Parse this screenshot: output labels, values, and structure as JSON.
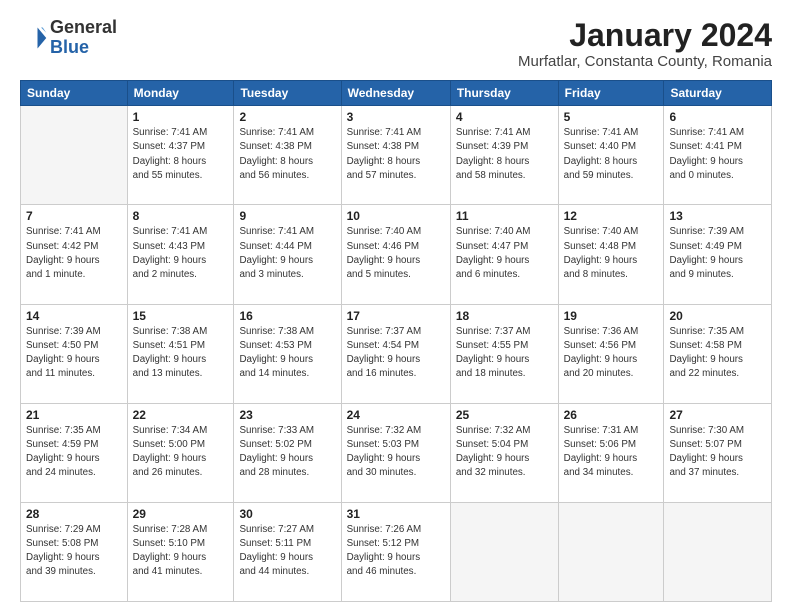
{
  "header": {
    "logo_general": "General",
    "logo_blue": "Blue",
    "title": "January 2024",
    "subtitle": "Murfatlar, Constanta County, Romania"
  },
  "weekdays": [
    "Sunday",
    "Monday",
    "Tuesday",
    "Wednesday",
    "Thursday",
    "Friday",
    "Saturday"
  ],
  "weeks": [
    [
      {
        "num": "",
        "info": ""
      },
      {
        "num": "1",
        "info": "Sunrise: 7:41 AM\nSunset: 4:37 PM\nDaylight: 8 hours\nand 55 minutes."
      },
      {
        "num": "2",
        "info": "Sunrise: 7:41 AM\nSunset: 4:38 PM\nDaylight: 8 hours\nand 56 minutes."
      },
      {
        "num": "3",
        "info": "Sunrise: 7:41 AM\nSunset: 4:38 PM\nDaylight: 8 hours\nand 57 minutes."
      },
      {
        "num": "4",
        "info": "Sunrise: 7:41 AM\nSunset: 4:39 PM\nDaylight: 8 hours\nand 58 minutes."
      },
      {
        "num": "5",
        "info": "Sunrise: 7:41 AM\nSunset: 4:40 PM\nDaylight: 8 hours\nand 59 minutes."
      },
      {
        "num": "6",
        "info": "Sunrise: 7:41 AM\nSunset: 4:41 PM\nDaylight: 9 hours\nand 0 minutes."
      }
    ],
    [
      {
        "num": "7",
        "info": "Sunrise: 7:41 AM\nSunset: 4:42 PM\nDaylight: 9 hours\nand 1 minute."
      },
      {
        "num": "8",
        "info": "Sunrise: 7:41 AM\nSunset: 4:43 PM\nDaylight: 9 hours\nand 2 minutes."
      },
      {
        "num": "9",
        "info": "Sunrise: 7:41 AM\nSunset: 4:44 PM\nDaylight: 9 hours\nand 3 minutes."
      },
      {
        "num": "10",
        "info": "Sunrise: 7:40 AM\nSunset: 4:46 PM\nDaylight: 9 hours\nand 5 minutes."
      },
      {
        "num": "11",
        "info": "Sunrise: 7:40 AM\nSunset: 4:47 PM\nDaylight: 9 hours\nand 6 minutes."
      },
      {
        "num": "12",
        "info": "Sunrise: 7:40 AM\nSunset: 4:48 PM\nDaylight: 9 hours\nand 8 minutes."
      },
      {
        "num": "13",
        "info": "Sunrise: 7:39 AM\nSunset: 4:49 PM\nDaylight: 9 hours\nand 9 minutes."
      }
    ],
    [
      {
        "num": "14",
        "info": "Sunrise: 7:39 AM\nSunset: 4:50 PM\nDaylight: 9 hours\nand 11 minutes."
      },
      {
        "num": "15",
        "info": "Sunrise: 7:38 AM\nSunset: 4:51 PM\nDaylight: 9 hours\nand 13 minutes."
      },
      {
        "num": "16",
        "info": "Sunrise: 7:38 AM\nSunset: 4:53 PM\nDaylight: 9 hours\nand 14 minutes."
      },
      {
        "num": "17",
        "info": "Sunrise: 7:37 AM\nSunset: 4:54 PM\nDaylight: 9 hours\nand 16 minutes."
      },
      {
        "num": "18",
        "info": "Sunrise: 7:37 AM\nSunset: 4:55 PM\nDaylight: 9 hours\nand 18 minutes."
      },
      {
        "num": "19",
        "info": "Sunrise: 7:36 AM\nSunset: 4:56 PM\nDaylight: 9 hours\nand 20 minutes."
      },
      {
        "num": "20",
        "info": "Sunrise: 7:35 AM\nSunset: 4:58 PM\nDaylight: 9 hours\nand 22 minutes."
      }
    ],
    [
      {
        "num": "21",
        "info": "Sunrise: 7:35 AM\nSunset: 4:59 PM\nDaylight: 9 hours\nand 24 minutes."
      },
      {
        "num": "22",
        "info": "Sunrise: 7:34 AM\nSunset: 5:00 PM\nDaylight: 9 hours\nand 26 minutes."
      },
      {
        "num": "23",
        "info": "Sunrise: 7:33 AM\nSunset: 5:02 PM\nDaylight: 9 hours\nand 28 minutes."
      },
      {
        "num": "24",
        "info": "Sunrise: 7:32 AM\nSunset: 5:03 PM\nDaylight: 9 hours\nand 30 minutes."
      },
      {
        "num": "25",
        "info": "Sunrise: 7:32 AM\nSunset: 5:04 PM\nDaylight: 9 hours\nand 32 minutes."
      },
      {
        "num": "26",
        "info": "Sunrise: 7:31 AM\nSunset: 5:06 PM\nDaylight: 9 hours\nand 34 minutes."
      },
      {
        "num": "27",
        "info": "Sunrise: 7:30 AM\nSunset: 5:07 PM\nDaylight: 9 hours\nand 37 minutes."
      }
    ],
    [
      {
        "num": "28",
        "info": "Sunrise: 7:29 AM\nSunset: 5:08 PM\nDaylight: 9 hours\nand 39 minutes."
      },
      {
        "num": "29",
        "info": "Sunrise: 7:28 AM\nSunset: 5:10 PM\nDaylight: 9 hours\nand 41 minutes."
      },
      {
        "num": "30",
        "info": "Sunrise: 7:27 AM\nSunset: 5:11 PM\nDaylight: 9 hours\nand 44 minutes."
      },
      {
        "num": "31",
        "info": "Sunrise: 7:26 AM\nSunset: 5:12 PM\nDaylight: 9 hours\nand 46 minutes."
      },
      {
        "num": "",
        "info": ""
      },
      {
        "num": "",
        "info": ""
      },
      {
        "num": "",
        "info": ""
      }
    ]
  ]
}
